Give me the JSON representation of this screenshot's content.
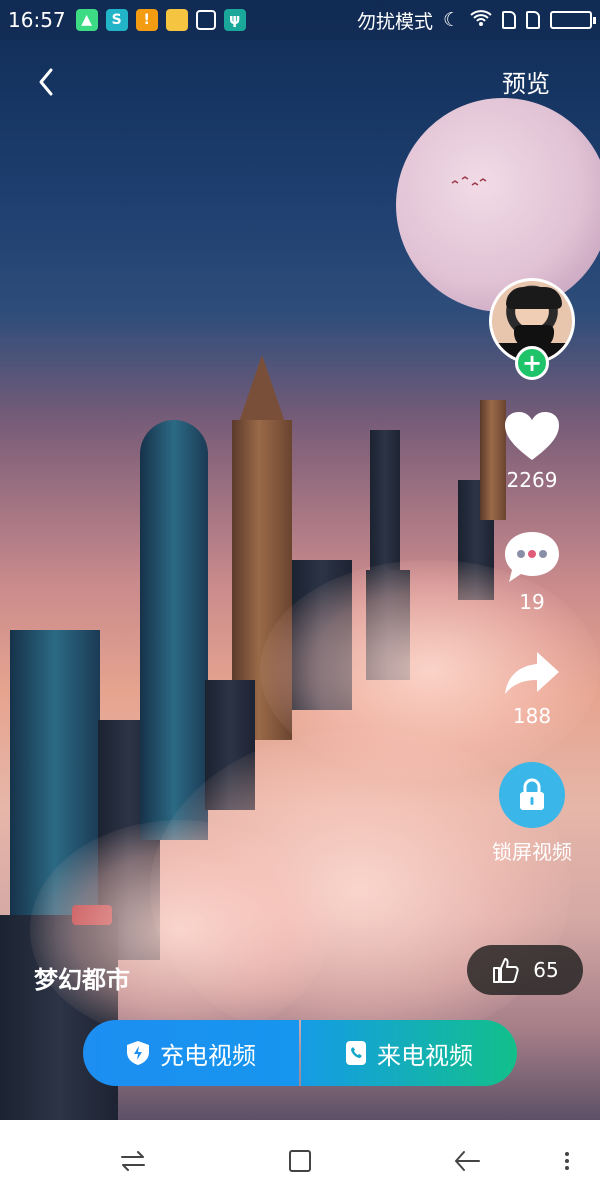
{
  "status_bar": {
    "time": "16:57",
    "dnd_label": "勿扰模式",
    "notification_icons": [
      "android-icon",
      "swirl-app-icon",
      "warning-icon",
      "folder-icon",
      "broom-icon",
      "usb-icon"
    ],
    "system_icons": [
      "moon-icon",
      "wifi-icon",
      "sim-icon",
      "sim-icon",
      "battery-icon"
    ]
  },
  "topbar": {
    "back_icon": "chevron-left-icon",
    "preview_label": "预览"
  },
  "side": {
    "like_count": "2269",
    "comment_count": "19",
    "share_count": "188",
    "lock_label": "锁屏视频"
  },
  "bottom": {
    "title": "梦幻都市",
    "thumb_count": "65",
    "charge_label": "充电视频",
    "call_label": "来电视频"
  },
  "colors": {
    "accent_blue": "#1d8ef2",
    "accent_green": "#12c08a",
    "follow_green": "#1fc36a",
    "lock_blue": "#3bb6e8"
  }
}
